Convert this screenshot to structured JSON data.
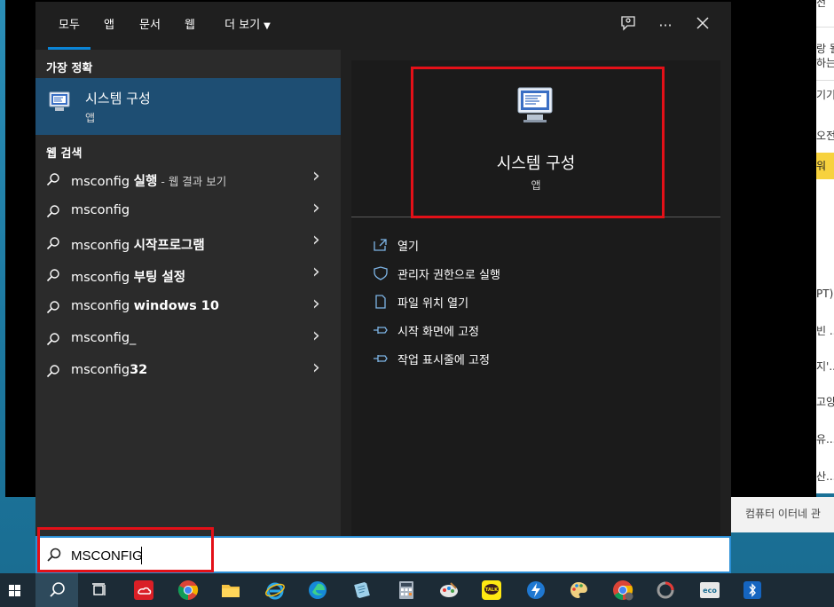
{
  "tabs": [
    {
      "label": "모두",
      "active": true
    },
    {
      "label": "앱",
      "active": false
    },
    {
      "label": "문서",
      "active": false
    },
    {
      "label": "웹",
      "active": false
    },
    {
      "label": "더 보기",
      "active": false
    }
  ],
  "top_icons": [
    "feedback-icon",
    "more-icon",
    "close-icon"
  ],
  "best_match": {
    "section_title": "가장 정확",
    "name": "시스템 구성",
    "kind": "앱"
  },
  "web_search": {
    "section_title": "웹 검색",
    "items": [
      {
        "prefix": "msconfig ",
        "bold": "실행",
        "suffix": " - 웹 결과 보기"
      },
      {
        "prefix": "msconfig",
        "bold": "",
        "suffix": ""
      },
      {
        "prefix": "msconfig ",
        "bold": "시작프로그램",
        "suffix": ""
      },
      {
        "prefix": "msconfig ",
        "bold": "부팅 설정",
        "suffix": ""
      },
      {
        "prefix": "msconfig ",
        "bold": "windows 10",
        "suffix": ""
      },
      {
        "prefix": "msconfig_",
        "bold": "",
        "suffix": ""
      },
      {
        "prefix": "msconfig",
        "bold": "32",
        "suffix": ""
      }
    ]
  },
  "detail": {
    "name": "시스템 구성",
    "kind": "앱",
    "actions": [
      {
        "label": "열기",
        "icon": "open-icon"
      },
      {
        "label": "관리자 권한으로 실행",
        "icon": "shield-icon"
      },
      {
        "label": "파일 위치 열기",
        "icon": "file-location-icon"
      },
      {
        "label": "시작 화면에 고정",
        "icon": "pin-icon"
      },
      {
        "label": "작업 표시줄에 고정",
        "icon": "pin-icon"
      }
    ]
  },
  "search": {
    "value": "MSCONFIG"
  },
  "background": {
    "right_snippets": [
      "전",
      "랑 될",
      "하는",
      "기기",
      "오전",
      "워",
      "PT)",
      "빈 ..",
      "지'..",
      "고양",
      "유...",
      "산..."
    ],
    "bottom_snippet": "컴퓨터 이터네 관"
  },
  "taskbar_icons": [
    "windows-start-icon",
    "search-icon",
    "task-view-icon",
    "creative-cloud-icon",
    "chrome-icon",
    "file-explorer-icon",
    "internet-explorer-icon",
    "edge-icon",
    "notepad-icon",
    "calculator-icon",
    "paint-icon",
    "kakaotalk-icon",
    "bolt-app-icon",
    "paint-palette-icon",
    "chrome-user-icon",
    "ring-app-icon",
    "eco-app-icon",
    "bluetooth-app-icon"
  ],
  "colors": {
    "accent": "#0a84d6",
    "highlight": "#e31018",
    "selected_row": "#1e4e73"
  }
}
